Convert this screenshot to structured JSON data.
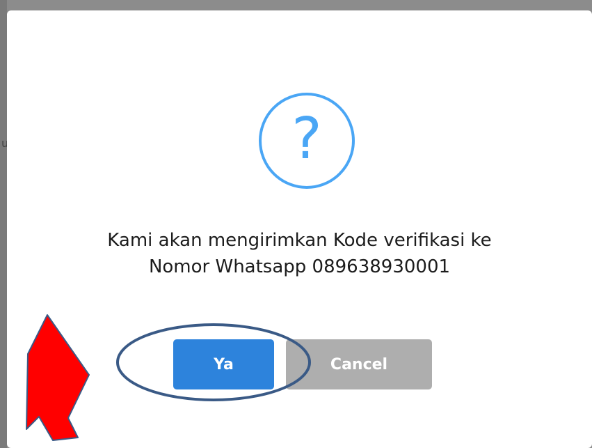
{
  "background": {
    "glyph": "u"
  },
  "dialog": {
    "icon": "question-circle-icon",
    "icon_glyph": "?",
    "icon_color": "#4aa6f5",
    "message_line1": "Kami akan mengirimkan Kode verifikasi ke",
    "message_line2": "Nomor Whatsapp 089638930001",
    "confirm_label": "Ya",
    "cancel_label": "Cancel",
    "confirm_color": "#2d83dc",
    "cancel_color": "#aeaeae"
  },
  "annotation": {
    "arrow_color": "#ff0000",
    "ellipse_color": "#3a5a86",
    "highlighted": "confirm-button"
  }
}
